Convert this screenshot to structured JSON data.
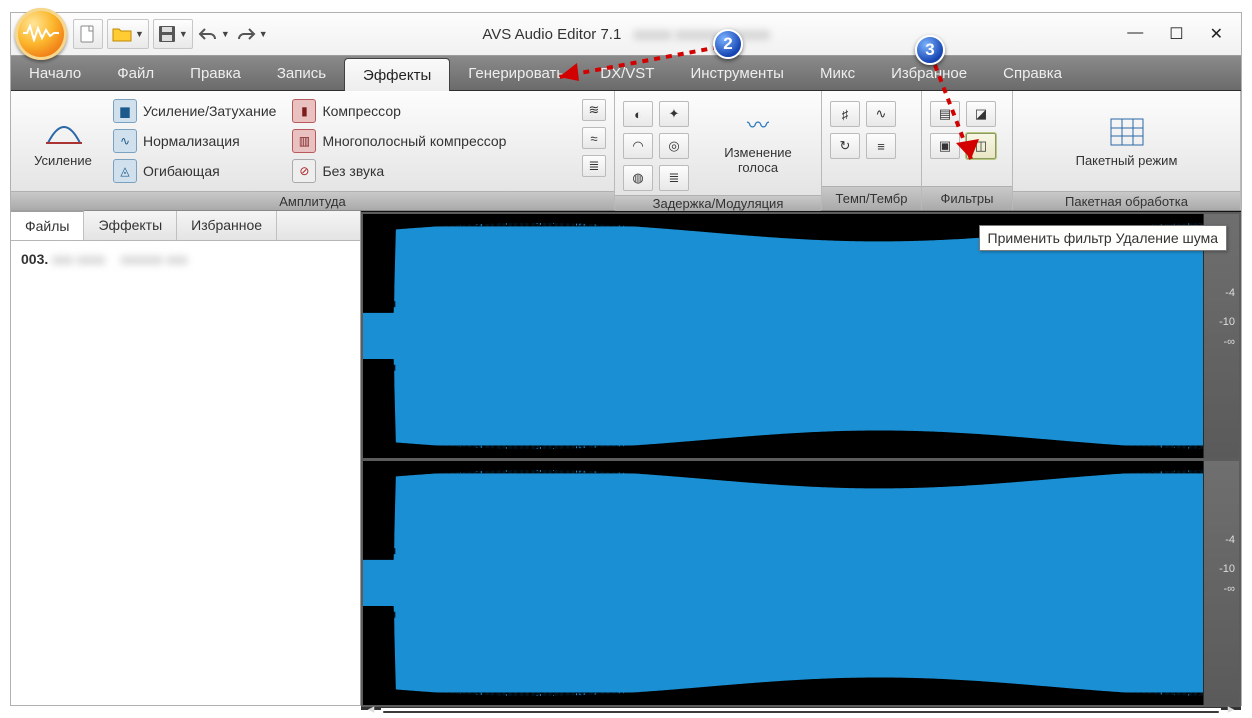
{
  "app": {
    "title": "AVS Audio Editor 7.1"
  },
  "window_controls": {
    "min": "—",
    "max": "☐",
    "close": "✕"
  },
  "tabs": {
    "items": [
      "Начало",
      "Файл",
      "Правка",
      "Запись",
      "Эффекты",
      "Генерировать",
      "DX/VST",
      "Инструменты",
      "Микс",
      "Избранное",
      "Справка"
    ],
    "active_index": 4
  },
  "ribbon": {
    "amplitude": {
      "caption": "Амплитуда",
      "big": "Усиление",
      "col1": [
        "Усиление/Затухание",
        "Нормализация",
        "Огибающая"
      ],
      "col2": [
        "Компрессор",
        "Многополосный компрессор",
        "Без звука"
      ]
    },
    "delay": {
      "caption": "Задержка/Модуляция",
      "big": "Изменение голоса"
    },
    "tempo": {
      "caption": "Темп/Тембр"
    },
    "filters": {
      "caption": "Фильтры"
    },
    "batch": {
      "caption": "Пакетная обработка",
      "big": "Пакетный режим"
    }
  },
  "side": {
    "tabs": [
      "Файлы",
      "Эффекты",
      "Избранное"
    ],
    "active_index": 0,
    "file": "003."
  },
  "tooltip": "Применить фильтр Удаление шума",
  "scale_ticks": [
    "-4",
    "-10",
    "-∞"
  ],
  "callouts": {
    "a": "2",
    "b": "3"
  }
}
